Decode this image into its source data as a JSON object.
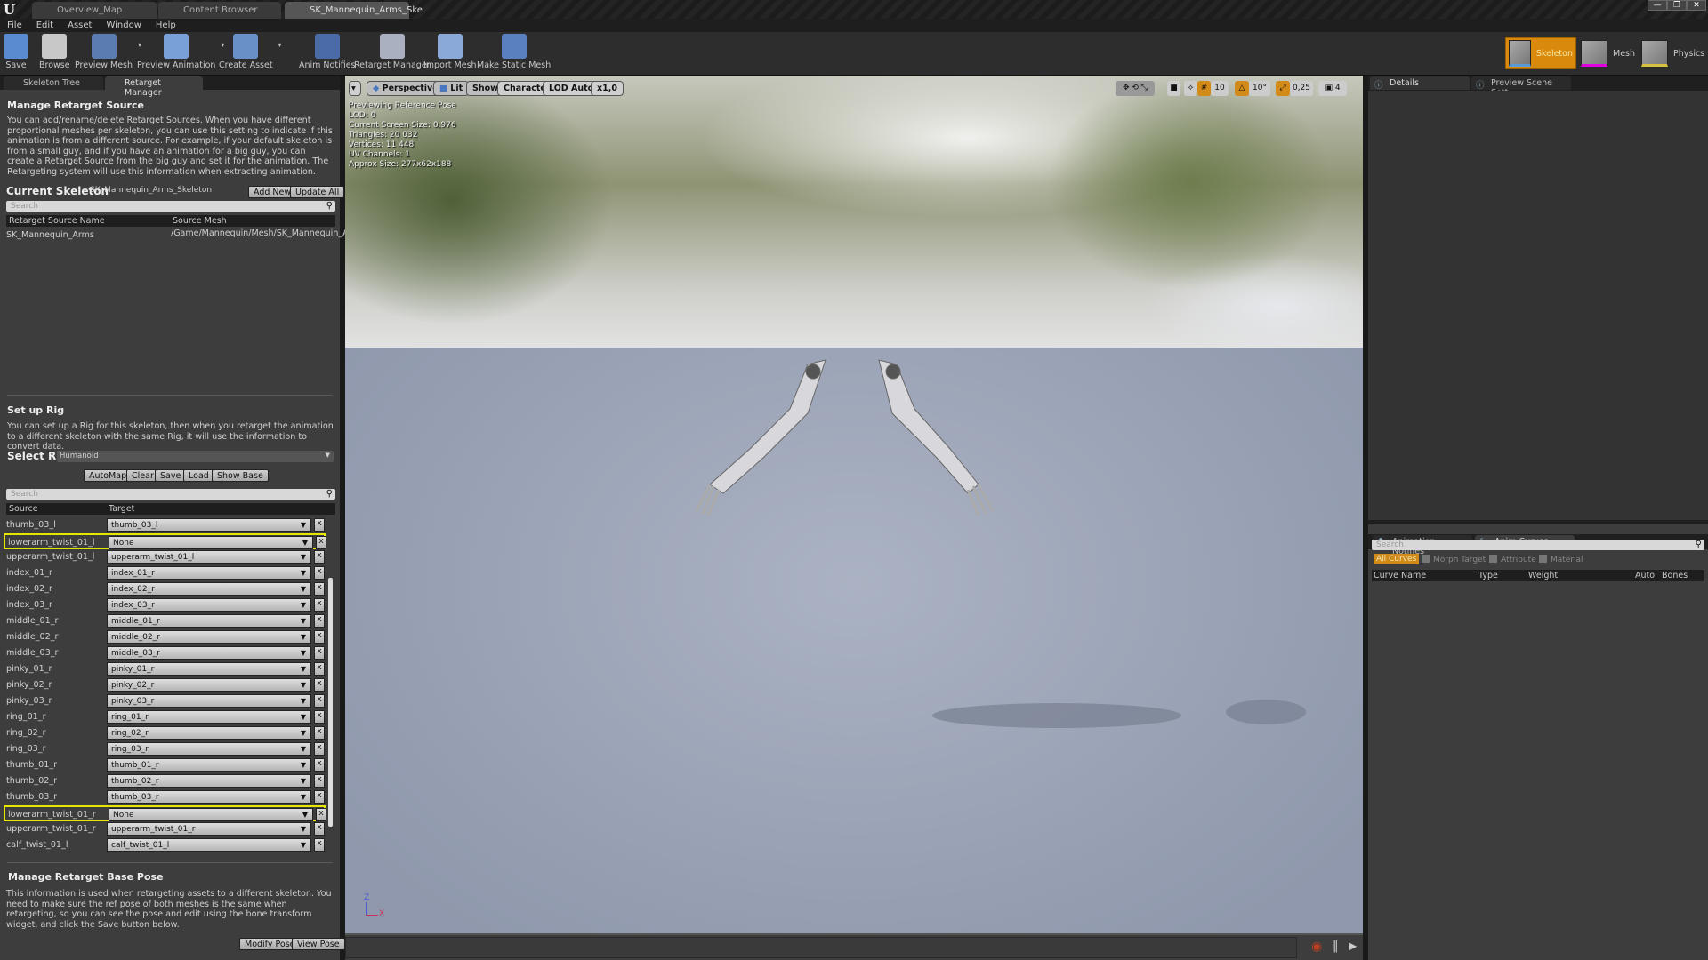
{
  "window": {
    "tabs": [
      "Overview_Map",
      "Content Browser",
      "SK_Mannequin_Arms_Ske"
    ],
    "controls": [
      "—",
      "❐",
      "✕"
    ]
  },
  "menu": [
    "File",
    "Edit",
    "Asset",
    "Window",
    "Help"
  ],
  "toolbar": {
    "items": [
      {
        "label": "Save",
        "icon": "save-icon",
        "dd": false
      },
      {
        "label": "Browse",
        "icon": "magnifier-icon",
        "dd": false
      },
      {
        "label": "Preview Mesh",
        "icon": "preview-mesh-icon",
        "dd": true
      },
      {
        "label": "Preview Animation",
        "icon": "preview-animation-icon",
        "dd": true
      },
      {
        "label": "Create Asset",
        "icon": "create-asset-icon",
        "dd": true
      },
      {
        "label": "Anim Notifies",
        "icon": "anim-notifies-icon",
        "dd": false
      },
      {
        "label": "Retarget Manager",
        "icon": "retarget-manager-icon",
        "dd": false
      },
      {
        "label": "Import Mesh",
        "icon": "import-mesh-icon",
        "dd": false
      },
      {
        "label": "Make Static Mesh",
        "icon": "make-static-mesh-icon",
        "dd": false
      }
    ],
    "modes": [
      {
        "label": "Skeleton",
        "active": true,
        "color": "#5b9bd5"
      },
      {
        "label": "Mesh",
        "active": false,
        "color": "#e000e0"
      },
      {
        "label": "Physics",
        "active": false,
        "color": "#d8c040"
      }
    ]
  },
  "left": {
    "tabs": [
      "Skeleton Tree",
      "Retarget Manager"
    ],
    "source": {
      "title": "Manage Retarget Source",
      "desc": "You can add/rename/delete Retarget Sources. When you have different proportional meshes per skeleton, you can use this setting to indicate if this animation is from a different source. For example, if your default skeleton is from a small guy, and if you have an animation for a big guy, you can create a Retarget Source from the big guy and set it for the animation. The Retargeting system will use this information when extracting animation.",
      "current_label": "Current Skeleton",
      "current_value": "SK_Mannequin_Arms_Skeleton",
      "add_new": "Add New",
      "update_all": "Update All",
      "search_placeholder": "Search",
      "columns": [
        "Retarget Source Name",
        "Source Mesh"
      ],
      "rows": [
        [
          "SK_Mannequin_Arms",
          "/Game/Mannequin/Mesh/SK_Mannequin_Arm"
        ]
      ]
    },
    "rig": {
      "title": "Set up Rig",
      "desc": "You can set up a Rig for this skeleton, then when you retarget the animation to a different skeleton with the same Rig, it will use the information to convert data.",
      "select_label": "Select Rig",
      "select_value": "Humanoid",
      "buttons": [
        "AutoMap",
        "Clear",
        "Save",
        "Load",
        "Show Base"
      ],
      "search_placeholder": "Search",
      "columns": [
        "Source",
        "Target"
      ],
      "rows": [
        {
          "source": "thumb_03_l",
          "target": "thumb_03_l",
          "hl": false
        },
        {
          "source": "lowerarm_twist_01_l",
          "target": "None",
          "hl": true
        },
        {
          "source": "upperarm_twist_01_l",
          "target": "upperarm_twist_01_l",
          "hl": false
        },
        {
          "source": "index_01_r",
          "target": "index_01_r",
          "hl": false
        },
        {
          "source": "index_02_r",
          "target": "index_02_r",
          "hl": false
        },
        {
          "source": "index_03_r",
          "target": "index_03_r",
          "hl": false
        },
        {
          "source": "middle_01_r",
          "target": "middle_01_r",
          "hl": false
        },
        {
          "source": "middle_02_r",
          "target": "middle_02_r",
          "hl": false
        },
        {
          "source": "middle_03_r",
          "target": "middle_03_r",
          "hl": false
        },
        {
          "source": "pinky_01_r",
          "target": "pinky_01_r",
          "hl": false
        },
        {
          "source": "pinky_02_r",
          "target": "pinky_02_r",
          "hl": false
        },
        {
          "source": "pinky_03_r",
          "target": "pinky_03_r",
          "hl": false
        },
        {
          "source": "ring_01_r",
          "target": "ring_01_r",
          "hl": false
        },
        {
          "source": "ring_02_r",
          "target": "ring_02_r",
          "hl": false
        },
        {
          "source": "ring_03_r",
          "target": "ring_03_r",
          "hl": false
        },
        {
          "source": "thumb_01_r",
          "target": "thumb_01_r",
          "hl": false
        },
        {
          "source": "thumb_02_r",
          "target": "thumb_02_r",
          "hl": false
        },
        {
          "source": "thumb_03_r",
          "target": "thumb_03_r",
          "hl": false
        },
        {
          "source": "lowerarm_twist_01_r",
          "target": "None",
          "hl": true
        },
        {
          "source": "upperarm_twist_01_r",
          "target": "upperarm_twist_01_r",
          "hl": false
        },
        {
          "source": "calf_twist_01_l",
          "target": "calf_twist_01_l",
          "hl": false
        }
      ],
      "clear_label": "x"
    },
    "base_pose": {
      "title": "Manage Retarget Base Pose",
      "desc": "This information is used when retargeting assets to a different skeleton. You need to make sure the ref pose of both meshes is the same when retargeting, so you can see the pose and edit using the bone transform widget, and click the Save button below.",
      "modify": "Modify Pose",
      "view": "View Pose"
    }
  },
  "viewport": {
    "buttons": [
      "Perspective",
      "Lit",
      "Show",
      "Character",
      "LOD Auto",
      "x1,0"
    ],
    "stats": [
      "Previewing Reference Pose",
      "LOD: 0",
      "Current Screen Size: 0,976",
      "Triangles: 20 032",
      "Vertices: 11 448",
      "UV Channels: 1",
      "Approx Size: 277x62x188"
    ],
    "snap": {
      "grid": "10",
      "rotation": "10°",
      "scale": "0,25",
      "camera_speed": "4"
    },
    "axis": {
      "z": "Z",
      "x": "X"
    }
  },
  "right": {
    "top_tabs": [
      "Details",
      "Preview Scene Sett"
    ],
    "bottom_tabs": [
      "Animation Notifies",
      "Anim Curves"
    ],
    "search_placeholder": "Search",
    "filters": {
      "all": "All Curves",
      "others": [
        "Morph Target",
        "Attribute",
        "Material"
      ]
    },
    "columns": [
      "Curve Name",
      "Type",
      "Weight",
      "Auto",
      "Bones"
    ]
  },
  "colors": {
    "accent": "#d28a18",
    "highlight": "#e6e600"
  }
}
